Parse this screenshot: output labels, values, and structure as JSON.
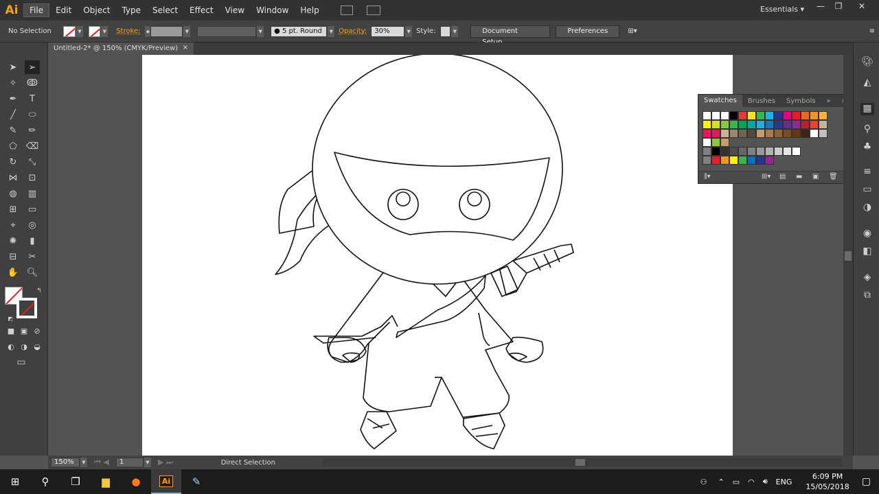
{
  "app": {
    "logo": "Ai",
    "workspace": "Essentials ▾"
  },
  "menu": [
    "File",
    "Edit",
    "Object",
    "Type",
    "Select",
    "Effect",
    "View",
    "Window",
    "Help"
  ],
  "control_bar": {
    "selection": "No Selection",
    "stroke_label": "Stroke:",
    "brush": "5 pt. Round",
    "opacity_label": "Opacity:",
    "opacity_value": "30%",
    "style_label": "Style:",
    "document_setup": "Document Setup",
    "preferences": "Preferences"
  },
  "document_tab": {
    "title": "Untitled-2* @ 150% (CMYK/Preview)",
    "close": "×"
  },
  "status_bar": {
    "zoom": "150%",
    "artboard": "1",
    "tool": "Direct Selection"
  },
  "swatches_panel": {
    "tabs": [
      "Swatches",
      "Brushes",
      "Symbols"
    ],
    "rows": [
      [
        "#ffffff",
        "#ffffff",
        "#ffffff",
        "#000000",
        "#e53935",
        "#f9e21c",
        "#3bb54a",
        "#1db3e8",
        "#2e3192",
        "#e6007e",
        "#ed1c24",
        "#f26522",
        "#f7941d",
        "#fbb040"
      ],
      [
        "#fff200",
        "#d7df23",
        "#8dc63f",
        "#39b54a",
        "#00a651",
        "#00a99d",
        "#27aae1",
        "#1c75bc",
        "#2b3990",
        "#662d91",
        "#92278f",
        "#be1e2d",
        "#ef4136",
        "#c2b59b"
      ],
      [
        "#ed145b",
        "#d91c5c",
        "#c7b299",
        "#998675",
        "#736357",
        "#534741",
        "#c69c6d",
        "#a67c52",
        "#8c6239",
        "#754c24",
        "#603913",
        "#3c2415",
        "#ffffff",
        "#c0c0c0"
      ],
      [
        "#ffffff",
        "#8dc63f",
        "#c69c6d"
      ],
      [
        "#808080",
        "#000000",
        "#333333",
        "#4d4d4d",
        "#666666",
        "#808080",
        "#999999",
        "#b3b3b3",
        "#cccccc",
        "#e6e6e6",
        "#ffffff"
      ],
      [
        "#808080",
        "#ed1c24",
        "#f7941d",
        "#fff200",
        "#39b54a",
        "#0072bc",
        "#2e3192",
        "#92278f"
      ]
    ]
  },
  "taskbar": {
    "time": "6:09 PM",
    "date": "15/05/2018",
    "lang": "ENG"
  }
}
